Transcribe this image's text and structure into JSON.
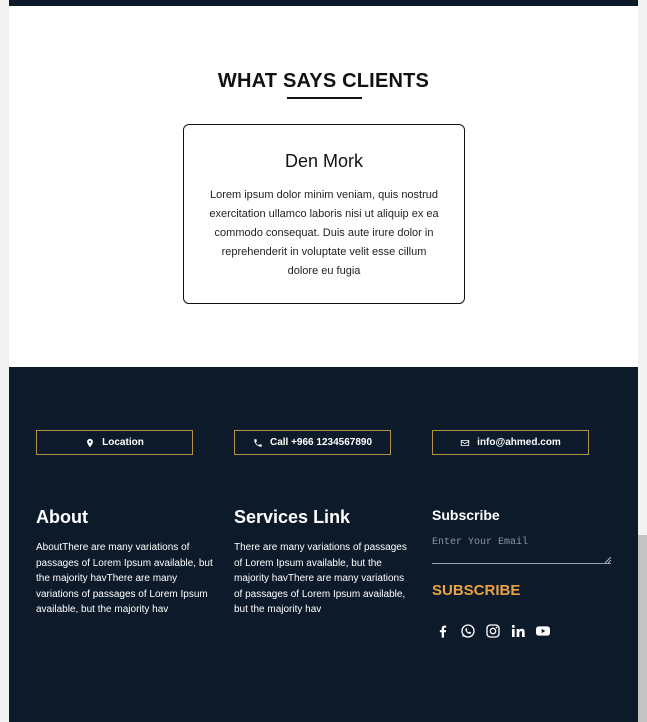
{
  "testimonials": {
    "title": "WHAT SAYS CLIENTS",
    "card": {
      "name": "Den Mork",
      "text": "Lorem ipsum dolor minim veniam, quis nostrud exercitation ullamco laboris nisi ut aliquip ex ea commodo consequat. Duis aute irure dolor in reprehenderit in voluptate velit esse cillum dolore eu fugia"
    }
  },
  "footer": {
    "contacts": {
      "location": {
        "label": "Location",
        "icon": "map-pin-icon"
      },
      "phone": {
        "label": "Call +966 1234567890",
        "icon": "phone-icon"
      },
      "email": {
        "label": "info@ahmed.com",
        "icon": "envelope-icon"
      }
    },
    "about": {
      "heading": "About",
      "text": "AboutThere are many variations of passages of Lorem Ipsum available, but the majority havThere are many variations of passages of Lorem Ipsum available, but the majority hav"
    },
    "services": {
      "heading": "Services Link",
      "text": "There are many variations of passages of Lorem Ipsum available, but the majority havThere are many variations of passages of Lorem Ipsum available, but the majority hav"
    },
    "subscribe": {
      "heading": "Subscribe",
      "placeholder": "Enter Your Email",
      "value": "",
      "button": "SUBSCRIBE"
    },
    "social": [
      "facebook-icon",
      "whatsapp-icon",
      "instagram-icon",
      "linkedin-icon",
      "youtube-icon"
    ]
  },
  "colors": {
    "dark_navy": "#0c1a2a",
    "gold_border": "#b39246",
    "subscribe_accent": "#e8a24a",
    "white": "#ffffff"
  }
}
